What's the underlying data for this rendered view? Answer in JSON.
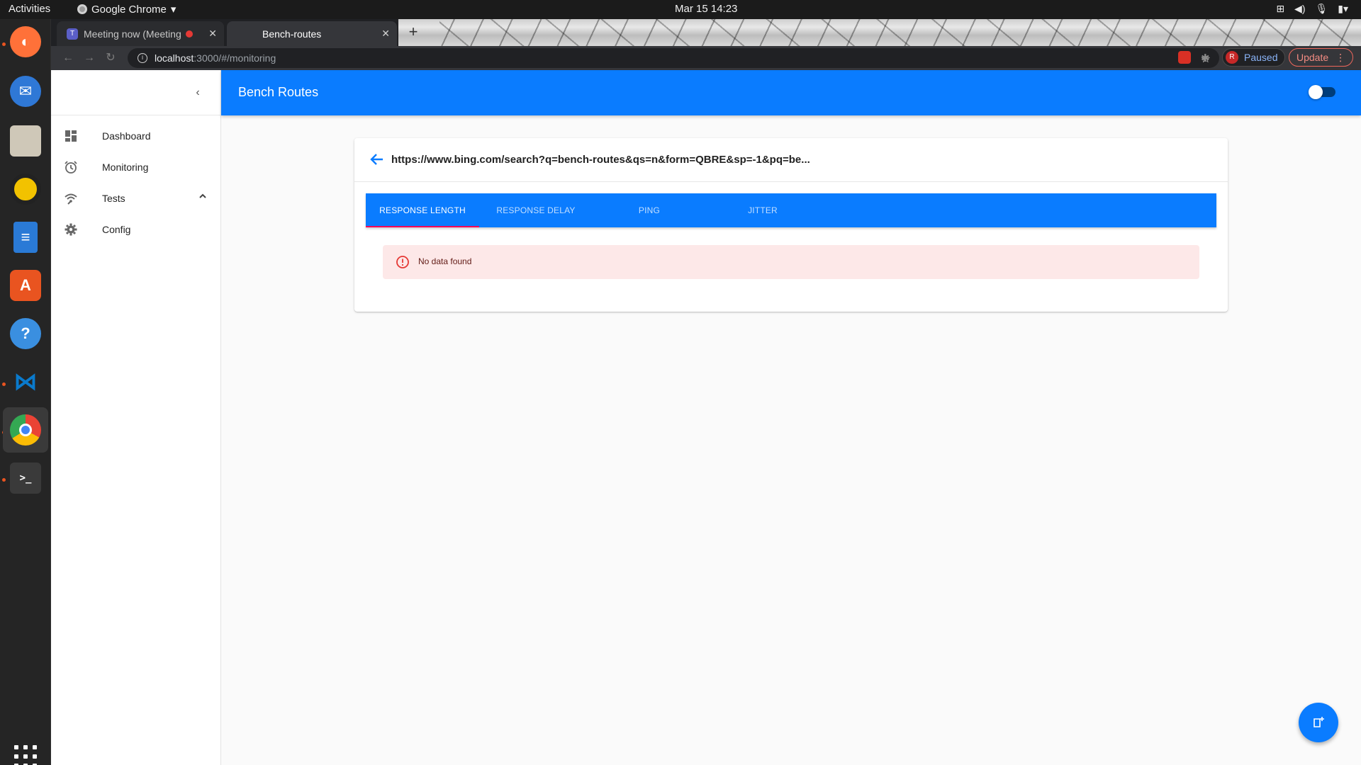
{
  "os": {
    "activities": "Activities",
    "app_menu": "Google Chrome",
    "clock": "Mar 15  14:23",
    "dock": [
      {
        "name": "firefox-icon",
        "color": "#ff7139"
      },
      {
        "name": "thunderbird-icon",
        "color": "#2f78d6"
      },
      {
        "name": "files-icon",
        "color": "#cfc8b8"
      },
      {
        "name": "rhythmbox-icon",
        "color": "#f2c200"
      },
      {
        "name": "libreoffice-writer-icon",
        "color": "#2a7ad6"
      },
      {
        "name": "software-center-icon",
        "color": "#e95420"
      },
      {
        "name": "help-icon",
        "color": "#3a8fe0"
      },
      {
        "name": "vscode-icon",
        "color": "#0a7acc"
      },
      {
        "name": "chrome-icon",
        "color": "#4285f4"
      },
      {
        "name": "terminal-icon",
        "color": "#3a3a3a"
      }
    ]
  },
  "browser": {
    "tabs": [
      {
        "label": "Meeting now (Meeting"
      },
      {
        "label": "Bench-routes"
      }
    ],
    "url_host": "localhost",
    "url_path": ":3000/#/monitoring",
    "profile_letter": "R",
    "profile_status": "Paused",
    "update_label": "Update"
  },
  "app": {
    "title": "Bench Routes",
    "nav": [
      {
        "label": "Dashboard",
        "icon": "dashboard-icon"
      },
      {
        "label": "Monitoring",
        "icon": "alarm-clock-icon"
      },
      {
        "label": "Tests",
        "icon": "wifi-icon"
      },
      {
        "label": "Config",
        "icon": "gear-icon"
      }
    ],
    "route_url": "https://www.bing.com/search?q=bench-routes&qs=n&form=QBRE&sp=-1&pq=be...",
    "tabs": [
      "RESPONSE LENGTH",
      "RESPONSE DELAY",
      "PING",
      "JITTER"
    ],
    "active_tab": "RESPONSE LENGTH",
    "alert": "No data found"
  },
  "colors": {
    "primary": "#0a7cff",
    "indicator": "#f50057",
    "alert_bg": "#fde8e8",
    "alert_text": "#611a15"
  }
}
